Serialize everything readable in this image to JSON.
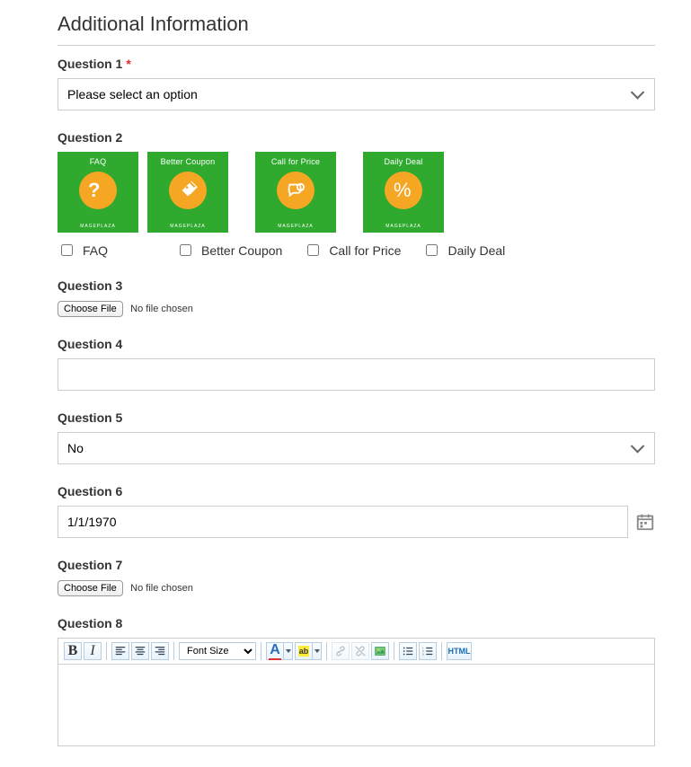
{
  "section_title": "Additional Information",
  "q1": {
    "label": "Question 1",
    "required": true,
    "value": "Please select an option"
  },
  "q2": {
    "label": "Question 2",
    "cards": [
      {
        "title": "FAQ",
        "icon": "question",
        "footer": "MAGEPLAZA"
      },
      {
        "title": "Better Coupon",
        "icon": "tags",
        "footer": "MAGEPLAZA"
      },
      {
        "title": "Call for Price",
        "icon": "chat",
        "footer": "MAGEPLAZA"
      },
      {
        "title": "Daily Deal",
        "icon": "percent",
        "footer": "MAGEPLAZA"
      }
    ],
    "options": [
      {
        "label": "FAQ",
        "checked": false
      },
      {
        "label": "Better Coupon",
        "checked": false
      },
      {
        "label": "Call for Price",
        "checked": false
      },
      {
        "label": "Daily Deal",
        "checked": false
      }
    ]
  },
  "q3": {
    "label": "Question 3",
    "button": "Choose File",
    "status": "No file chosen"
  },
  "q4": {
    "label": "Question 4",
    "value": ""
  },
  "q5": {
    "label": "Question 5",
    "value": "No"
  },
  "q6": {
    "label": "Question 6",
    "value": "1/1/1970"
  },
  "q7": {
    "label": "Question 7",
    "button": "Choose File",
    "status": "No file chosen"
  },
  "q8": {
    "label": "Question 8",
    "toolbar": {
      "font_size_label": "Font Size",
      "html_label": "HTML"
    }
  }
}
